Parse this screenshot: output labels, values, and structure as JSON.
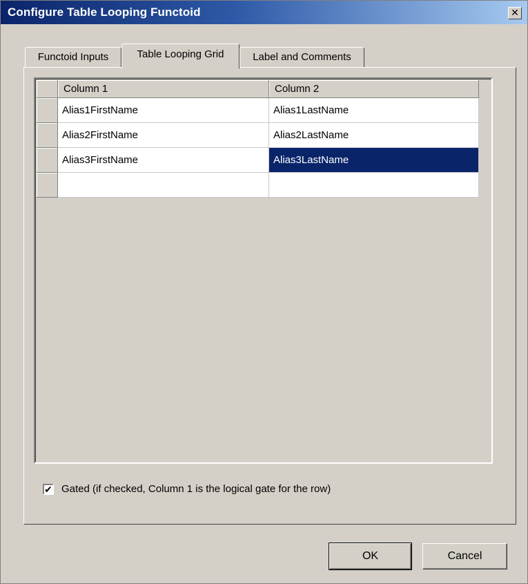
{
  "window": {
    "title": "Configure Table Looping Functoid",
    "close_glyph": "✕"
  },
  "tabs": [
    {
      "label": "Functoid Inputs",
      "active": false
    },
    {
      "label": "Table Looping Grid",
      "active": true
    },
    {
      "label": "Label and Comments",
      "active": false
    }
  ],
  "grid": {
    "columns": [
      "Column 1",
      "Column 2"
    ],
    "rows": [
      [
        "Alias1FirstName",
        "Alias1LastName"
      ],
      [
        "Alias2FirstName",
        "Alias2LastName"
      ],
      [
        "Alias3FirstName",
        "Alias3LastName"
      ],
      [
        "",
        ""
      ]
    ],
    "selected_cell": {
      "row": 2,
      "column": 1
    },
    "selected_color": "#0a246a"
  },
  "gated": {
    "checked": true,
    "check_glyph": "✔",
    "label": "Gated (if checked, Column 1 is the logical gate for the row)"
  },
  "buttons": {
    "ok": "OK",
    "cancel": "Cancel"
  },
  "colors": {
    "titlebar_start": "#0a246a",
    "titlebar_end": "#a6caf0",
    "dialog_face": "#d4d0c8"
  }
}
